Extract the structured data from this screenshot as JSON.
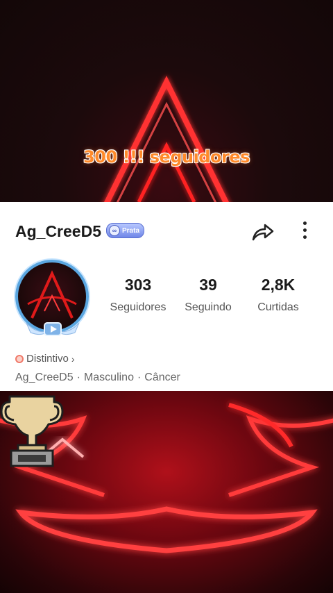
{
  "banner": {
    "caption": "300 !!! seguidores"
  },
  "profile": {
    "username": "Ag_CreeD5",
    "badge_label": "Prata",
    "stats": [
      {
        "value": "303",
        "label": "Seguidores"
      },
      {
        "value": "39",
        "label": "Seguindo"
      },
      {
        "value": "2,8K",
        "label": "Curtidas"
      }
    ],
    "distintivo_label": "Distintivo",
    "meta": {
      "name": "Ag_CreeD5",
      "gender": "Masculino",
      "sign": "Câncer",
      "separator": "·"
    }
  },
  "icons": {
    "share": "share-arrow-icon",
    "more": "more-vertical-icon",
    "trophy": "trophy-icon",
    "distintivo": "badge-icon"
  },
  "colors": {
    "neon_red": "#ff2a2a",
    "caption_orange": "#ff8a2a",
    "badge_blue": "#6f86e8",
    "avatar_ring": "#5aa6e0"
  }
}
